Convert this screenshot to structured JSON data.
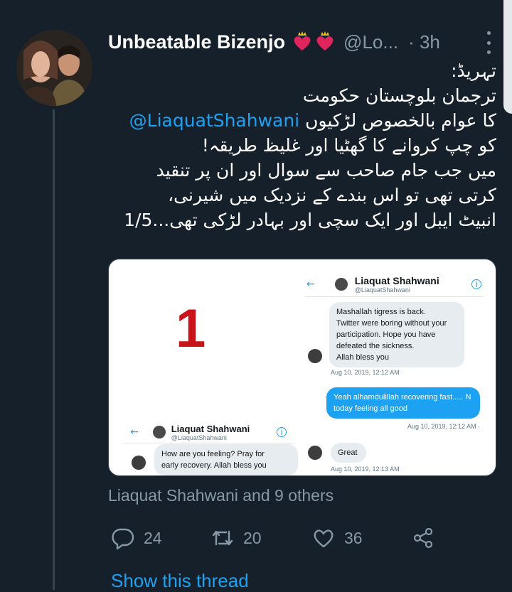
{
  "tweet": {
    "display_name": "Unbeatable Bizenjo",
    "handle": "@Lo...",
    "time_separator": "·",
    "time": "3h",
    "text_lines": [
      "تہریڈ:",
      "ترجمان بلوچستان حکومت",
      "کا عوام بالخصوص لڑکیوں",
      "کو چپ کروانے کا گھٹیا اور غلیظ طریقہ!",
      "میں جب جام صاحب سے سوال اور ان پر تنقید",
      "کرتی تھی تو اس بندے کے نزدیک میں شیرنی،",
      "انبیٹ ایبل اور ایک سچی اور بہادر لڑکی تھی...1/5"
    ],
    "mention": "@LiaquatShahwani",
    "icons": [
      "avatar",
      "heart-crown-icon",
      "more-vertical-icon",
      "reply-icon",
      "retweet-icon",
      "like-icon",
      "share-icon"
    ]
  },
  "media": {
    "number": "1",
    "top_screenshot": {
      "title": "Liaquat Shahwani",
      "subtitle": "@LiaquatShahwani",
      "message_in": [
        "Mashallah tigress is back.",
        "Twitter were boring without your",
        "participation. Hope you have",
        "defeated the sickness.",
        "Allah bless you"
      ],
      "stamp_in": "Aug 10, 2019, 12:12 AM",
      "message_out": [
        "Yeah alhamdulillah recovering fast..... N",
        "today feeling all good"
      ],
      "stamp_out": "Aug 10, 2019, 12:12 AM ·",
      "message_in_2": "Great",
      "stamp_in_2": "Aug 10, 2019, 12:13 AM"
    },
    "bottom_screenshot": {
      "title": "Liaquat Shahwani",
      "subtitle": "@LiaquatShahwani",
      "message_in": [
        "How are you feeling? Pray for",
        "early recovery. Allah bless you"
      ]
    }
  },
  "social_context": "Liaquat Shahwani and 9 others",
  "actions": {
    "replies": "24",
    "retweets": "20",
    "likes": "36"
  },
  "show_thread": "Show this thread",
  "colors": {
    "background": "#15202b",
    "accent": "#1da1f2",
    "muted": "#8899a6",
    "heart": "#e0245e",
    "number_red": "#c9141a"
  }
}
